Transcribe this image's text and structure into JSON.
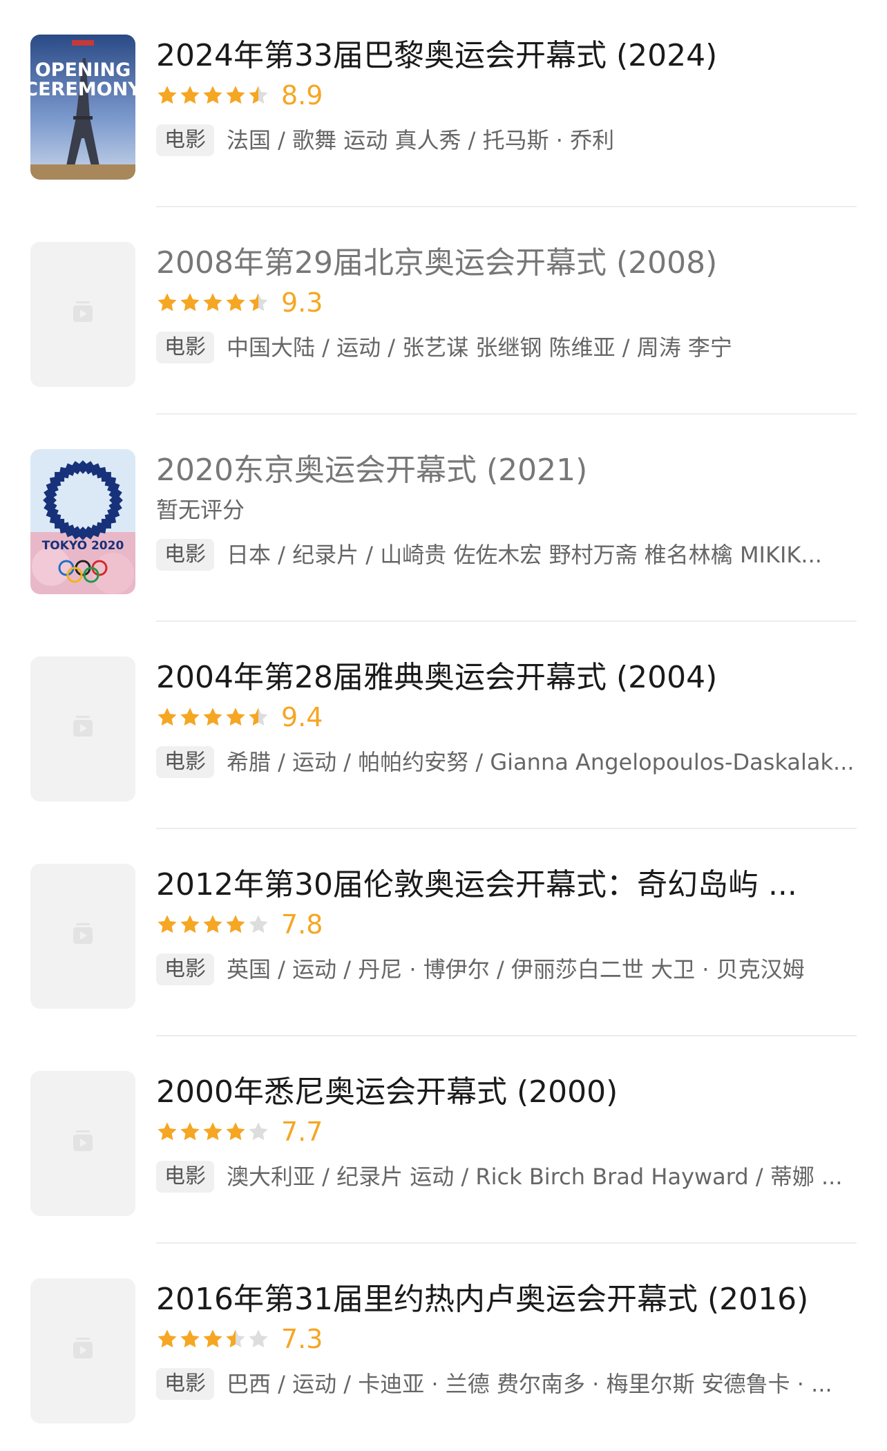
{
  "colors": {
    "star": "#f5a623",
    "star_empty": "#dddddd"
  },
  "items": [
    {
      "title": "2024年第33届巴黎奥运会开幕式 (2024)",
      "title_gray": false,
      "stars": 4.5,
      "score": "8.9",
      "no_rating": "",
      "tag": "电影",
      "meta": "法国 / 歌舞 运动 真人秀 / 托马斯 · 乔利",
      "poster": "paris",
      "poster_text": {
        "line1": "OPENING",
        "line2": "CEREMONY"
      }
    },
    {
      "title": "2008年第29届北京奥运会开幕式 (2008)",
      "title_gray": true,
      "stars": 4.5,
      "score": "9.3",
      "no_rating": "",
      "tag": "电影",
      "meta": "中国大陆 / 运动 / 张艺谋 张继钢 陈维亚 / 周涛 李宁",
      "poster": "placeholder"
    },
    {
      "title": "2020东京奥运会开幕式 (2021)",
      "title_gray": true,
      "stars": 0,
      "score": "",
      "no_rating": "暂无评分",
      "tag": "电影",
      "meta": "日本 / 纪录片 / 山崎贵 佐佐木宏 野村万斋 椎名林檎 MIKIK...",
      "poster": "tokyo",
      "poster_text": {
        "line1": "TOKYO 2020"
      }
    },
    {
      "title": "2004年第28届雅典奥运会开幕式 (2004)",
      "title_gray": false,
      "stars": 4.5,
      "score": "9.4",
      "no_rating": "",
      "tag": "电影",
      "meta": "希腊 / 运动 / 帕帕约安努 / Gianna Angelopoulos-Daskalak...",
      "poster": "placeholder"
    },
    {
      "title": "2012年第30届伦敦奥运会开幕式：奇幻岛屿 ...",
      "title_gray": false,
      "stars": 4,
      "score": "7.8",
      "no_rating": "",
      "tag": "电影",
      "meta": "英国 / 运动 / 丹尼 · 博伊尔 / 伊丽莎白二世 大卫 · 贝克汉姆",
      "poster": "placeholder"
    },
    {
      "title": "2000年悉尼奥运会开幕式 (2000)",
      "title_gray": false,
      "stars": 4,
      "score": "7.7",
      "no_rating": "",
      "tag": "电影",
      "meta": "澳大利亚 / 纪录片 运动 / Rick Birch Brad Hayward / 蒂娜 ...",
      "poster": "placeholder"
    },
    {
      "title": "2016年第31届里约热内卢奥运会开幕式 (2016)",
      "title_gray": false,
      "stars": 3.5,
      "score": "7.3",
      "no_rating": "",
      "tag": "电影",
      "meta": "巴西 / 运动 / 卡迪亚 · 兰德 费尔南多 · 梅里尔斯 安德鲁卡 · ...",
      "poster": "placeholder"
    }
  ]
}
